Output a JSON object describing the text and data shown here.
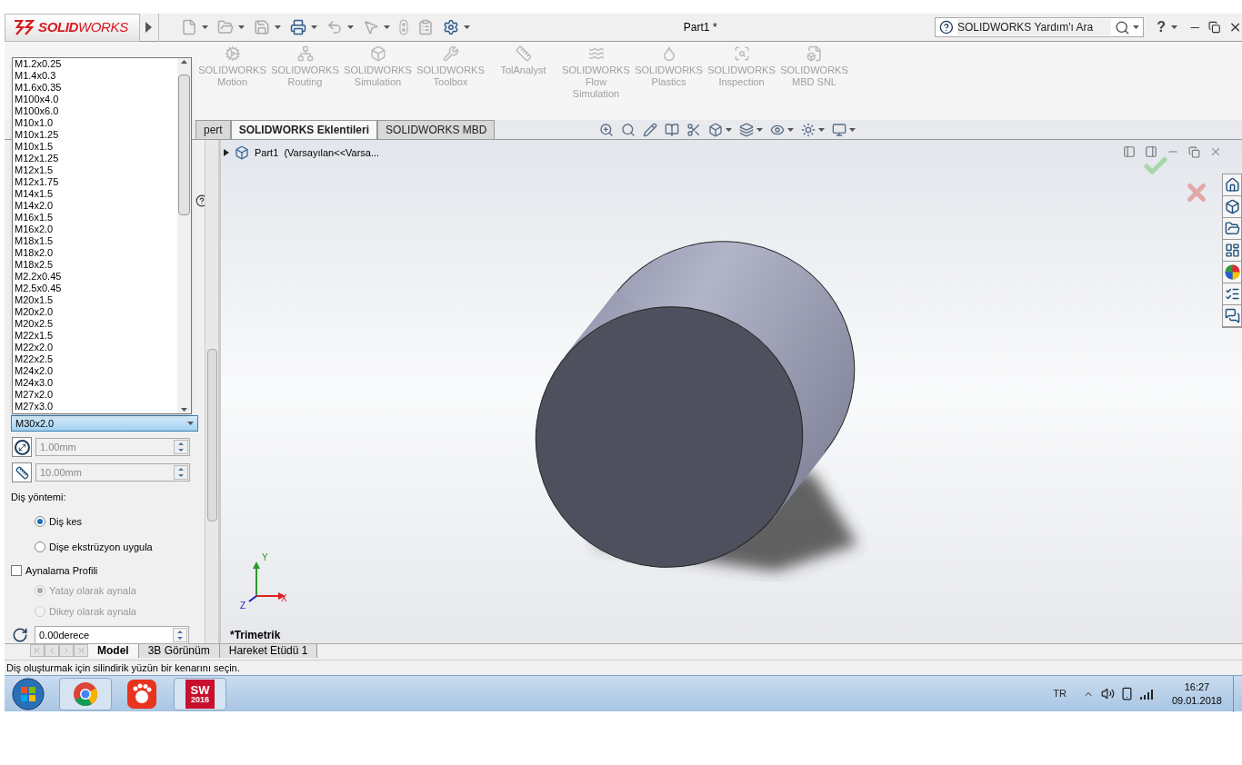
{
  "title_bar": {
    "logo": "**SOLID**WORKS",
    "title": "Part1 *",
    "help_search": {
      "placeholder": "SOLIDWORKS Yardım'ı Ara"
    },
    "help_label": "?"
  },
  "addins": [
    "SOLIDWORKS Motion",
    "SOLIDWORKS Routing",
    "SOLIDWORKS Simulation",
    "SOLIDWORKS Toolbox",
    "TolAnalyst",
    "SOLIDWORKS Flow Simulation",
    "SOLIDWORKS Plastics",
    "SOLIDWORKS Inspection",
    "SOLIDWORKS MBD SNL"
  ],
  "tabs": [
    {
      "label": "pert",
      "selected": false
    },
    {
      "label": "SOLIDWORKS Eklentileri",
      "selected": true
    },
    {
      "label": "SOLIDWORKS MBD",
      "selected": false
    }
  ],
  "thread_size": {
    "expanded": true,
    "value": "M30x2.0",
    "options": [
      "M1.2x0.25",
      "M1.4x0.3",
      "M1.6x0.35",
      "M100x4.0",
      "M100x6.0",
      "M10x1.0",
      "M10x1.25",
      "M10x1.5",
      "M12x1.25",
      "M12x1.5",
      "M12x1.75",
      "M14x1.5",
      "M14x2.0",
      "M16x1.5",
      "M16x2.0",
      "M18x1.5",
      "M18x2.0",
      "M18x2.5",
      "M2.2x0.45",
      "M2.5x0.45",
      "M20x1.5",
      "M20x2.0",
      "M20x2.5",
      "M22x1.5",
      "M22x2.0",
      "M22x2.5",
      "M24x2.0",
      "M24x3.0",
      "M27x2.0",
      "M27x3.0"
    ]
  },
  "offset_field": {
    "value": "1.00mm",
    "disabled": true
  },
  "length_field": {
    "value": "10.00mm",
    "disabled": true
  },
  "thread_method": {
    "label": "Diş yöntemi:",
    "options": [
      {
        "label": "Diş kes",
        "selected": true,
        "disabled": false
      },
      {
        "label": "Dişe ekstrüzyon uygula",
        "selected": false,
        "disabled": false
      }
    ]
  },
  "mirror_profile": {
    "label": "Aynalama Profili",
    "checked": false,
    "options": [
      {
        "label": "Yatay olarak aynala",
        "selected": true,
        "disabled": true
      },
      {
        "label": "Dikey olarak aynala",
        "selected": false,
        "disabled": true
      }
    ]
  },
  "angle_field": {
    "value": "0.00derece",
    "disabled": false
  },
  "feature_tree": {
    "label": "Part1  (Varsayılan<<Varsa...",
    "expanded": false
  },
  "view": {
    "orientation": "*Trimetrik",
    "triad": [
      "X",
      "Y",
      "Z"
    ]
  },
  "bottom_tabs": [
    {
      "label": "Model",
      "selected": true
    },
    {
      "label": "3B Görünüm",
      "selected": false
    },
    {
      "label": "Hareket Etüdü 1",
      "selected": false
    }
  ],
  "status_bar": "Diş oluşturmak için silindirik yüzün bir kenarını seçin.",
  "taskbar": {
    "sw_letters": "SW",
    "sw_year": "2016",
    "language": "TR",
    "time": "16:27",
    "date": "09.01.2018"
  }
}
